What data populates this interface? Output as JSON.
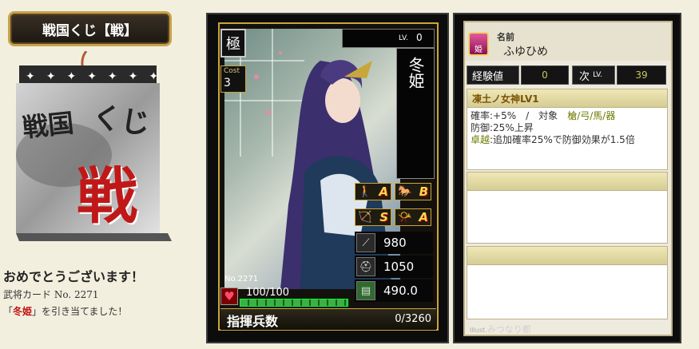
{
  "header": {
    "title": "戦国くじ【戦】"
  },
  "logo": {
    "line1": "戦国",
    "line2": "くじ",
    "big": "戦"
  },
  "message": {
    "congrats": "おめでとうございます！",
    "card_line": "武将カード No. 2271",
    "drawn_prefix": "「",
    "drawn_name": "冬姫",
    "drawn_suffix": "」を引き当てました！"
  },
  "card": {
    "rarity": "極",
    "cost_label": "Cost",
    "cost_value": "3",
    "level_label": "LV.",
    "level_value": "0",
    "name": "冬姫",
    "number_label": "No.",
    "number": "2271",
    "hp": "100/100",
    "hp_fraction": 1.0,
    "skills": [
      {
        "icon": "spear-soldier-icon",
        "grade": "A"
      },
      {
        "icon": "cavalry-icon",
        "grade": "B"
      },
      {
        "icon": "bow-icon",
        "grade": "S"
      },
      {
        "icon": "conch-horn-icon",
        "grade": "A"
      }
    ],
    "stats": [
      {
        "icon": "spear-icon",
        "value": "980"
      },
      {
        "icon": "helmet-icon",
        "value": "1050"
      },
      {
        "icon": "book-icon",
        "value": "490.0"
      }
    ],
    "troops_label": "指揮兵数",
    "troops_value": "0/3260"
  },
  "info": {
    "badge": "姫",
    "name_label": "名前",
    "furigana": "ふゆひめ",
    "exp_label": "経験値",
    "exp_value": "0",
    "next_label": "次",
    "next_lv": "LV.",
    "next_value": "39",
    "skill_name": "凍土ノ女神LV1",
    "skill_line1_a": "確率:+5%　/　対象　",
    "skill_line1_b": "槍/弓/馬/器",
    "skill_line2": "防御:25%上昇",
    "skill_line3_a": "卓越",
    "skill_line3_b": ":追加確率25%で防御効果が1.5倍",
    "illust_label": "Illust.",
    "illust_artist": "みつなり都"
  },
  "colors": {
    "accent_gold": "#c9a63a",
    "highlight_red": "#c01010",
    "hp_green": "#3cb043"
  }
}
